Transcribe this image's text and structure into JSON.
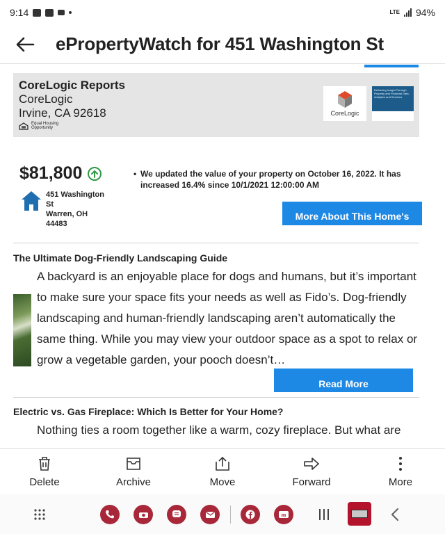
{
  "status_bar": {
    "time": "9:14",
    "network": "LTE",
    "battery": "94%"
  },
  "header": {
    "title": "ePropertyWatch for 451 Washington St"
  },
  "corelogic": {
    "title": "CoreLogic Reports",
    "company": "CoreLogic",
    "location": "Irvine, CA 92618",
    "eho_line1": "Equal Housing",
    "eho_line2": "Opportunity",
    "logo_text": "CoreLogic",
    "banner_text": "Delivering Insight Through Property and Financial Data, Analytics and Services"
  },
  "property": {
    "value": "$81,800",
    "address_line1": "451 Washington",
    "address_line2": "St",
    "address_line3": "Warren, OH",
    "address_line4": "44483",
    "update_note": "We updated the value of your property on October 16, 2022. It has increased 16.4% since 10/1/2021 12:00:00 AM",
    "more_button": "More About This Home's"
  },
  "articles": [
    {
      "title": "The Ultimate Dog-Friendly Landscaping Guide",
      "body": "A backyard is an enjoyable place for dogs and humans, but it’s important to make sure your space fits your needs as well as Fido’s. Dog-friendly landscaping and human-friendly landscaping aren’t automatically the same thing. While you may view your outdoor space as a spot to relax or grow a vegetable garden, your pooch doesn’t…",
      "button": "Read More"
    },
    {
      "title": "Electric vs. Gas Fireplace: Which Is Better for Your Home?",
      "body": "Nothing ties a room together like a warm, cozy fireplace. But what are"
    }
  ],
  "actions": [
    {
      "label": "Delete",
      "icon": "trash-icon"
    },
    {
      "label": "Archive",
      "icon": "archive-icon"
    },
    {
      "label": "Move",
      "icon": "move-icon"
    },
    {
      "label": "Forward",
      "icon": "forward-icon"
    },
    {
      "label": "More",
      "icon": "more-vertical-icon"
    }
  ],
  "colors": {
    "accent": "#1e88e5",
    "up": "#2e9a44",
    "house": "#1f6fb0"
  }
}
